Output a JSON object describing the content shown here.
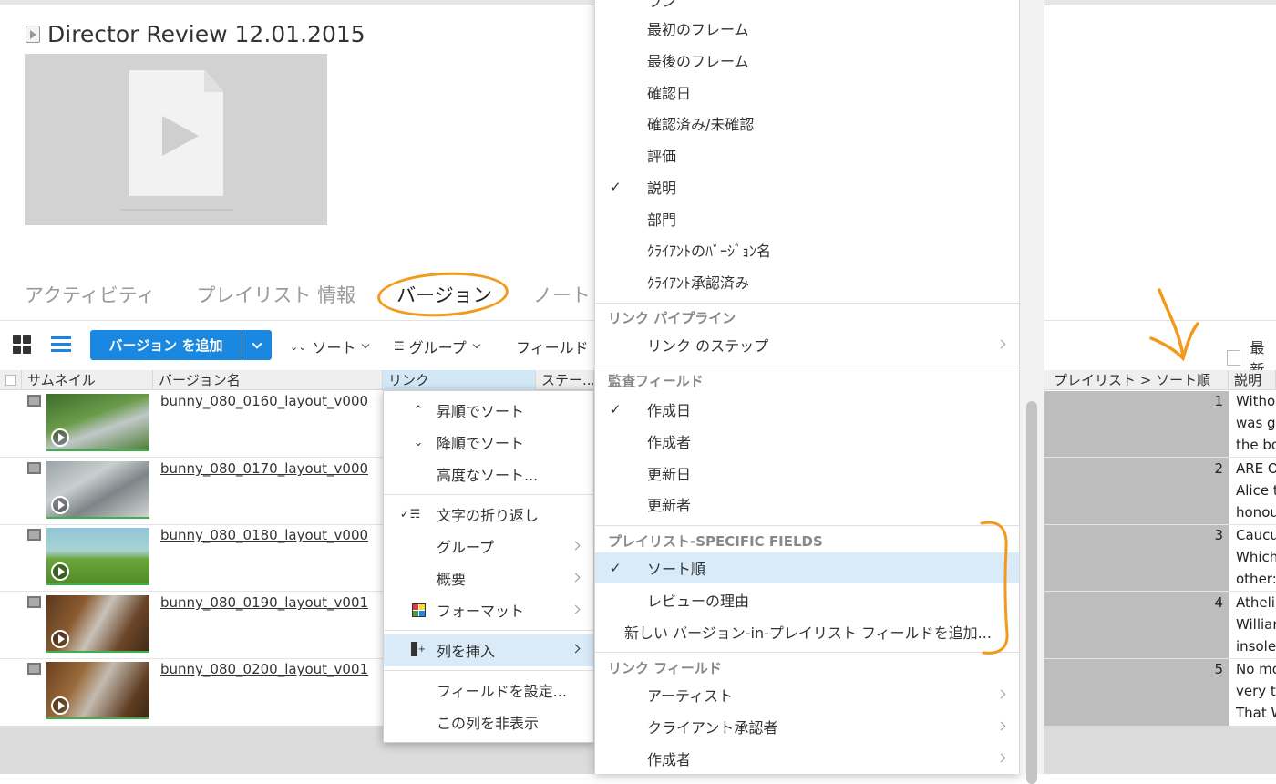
{
  "page": {
    "title": "Director Review 12.01.2015",
    "accent_color": "#1a88e0",
    "annotation_color": "#f39a1d"
  },
  "tabs": [
    {
      "label": "アクティビティ"
    },
    {
      "label": "プレイリスト 情報"
    },
    {
      "label": "バージョン"
    },
    {
      "label": "ノート"
    }
  ],
  "toolbar": {
    "add_label": "バージョン を追加",
    "sort_label": "ソート",
    "group_label": "グループ",
    "fields_label": "フィールド",
    "latest_label": "最新"
  },
  "columns": {
    "thumbnail": "サムネイル",
    "version_name": "バージョン名",
    "link": "リンク",
    "status": "ステー...",
    "sort_order": "プレイリスト > ソート順",
    "description": "説明"
  },
  "rows": [
    {
      "name": "bunny_080_0160_layout_v000",
      "sort": "1",
      "desc": [
        "Witho",
        "was g",
        "the bo"
      ]
    },
    {
      "name": "bunny_080_0170_layout_v000",
      "sort": "2",
      "desc": [
        "ARE O",
        "Alice t",
        "honou"
      ]
    },
    {
      "name": "bunny_080_0180_layout_v000",
      "sort": "3",
      "desc": [
        "Caucu",
        "Which",
        "other:"
      ]
    },
    {
      "name": "bunny_080_0190_layout_v001",
      "sort": "4",
      "desc": [
        "Atheli",
        "Willian",
        "insole"
      ]
    },
    {
      "name": "bunny_080_0200_layout_v001",
      "sort": "5",
      "desc": [
        "No mo",
        "very t",
        "That W"
      ]
    }
  ],
  "column_menu": [
    {
      "label": "昇順でソート",
      "icon": "chevron-up-icon"
    },
    {
      "label": "降順でソート",
      "icon": "chevron-down-icon"
    },
    {
      "label": "高度なソート..."
    },
    {
      "label": "文字の折り返し",
      "icon": "wrap-text-icon",
      "checked": true
    },
    {
      "label": "グループ",
      "submenu": true
    },
    {
      "label": "概要",
      "submenu": true
    },
    {
      "label": "フォーマット",
      "icon": "format-icon",
      "submenu": true
    },
    {
      "label": "列を挿入",
      "icon": "insert-column-icon",
      "submenu": true,
      "highlighted": true
    },
    {
      "label": "フィールドを設定..."
    },
    {
      "label": "この列を非表示"
    }
  ],
  "field_menu": {
    "cut_item": "ラン",
    "items_top": [
      {
        "label": "最初のフレーム"
      },
      {
        "label": "最後のフレーム"
      },
      {
        "label": "確認日"
      },
      {
        "label": "確認済み/未確認"
      },
      {
        "label": "評価"
      },
      {
        "label": "説明",
        "checked": true
      },
      {
        "label": "部門"
      },
      {
        "label": "ｸﾗｲｱﾝﾄのﾊﾞｰｼﾞｮﾝ名"
      },
      {
        "label": "ｸﾗｲｱﾝﾄ承認済み"
      }
    ],
    "section_pipeline": "リンク パイプライン",
    "pipeline_items": [
      {
        "label": "リンク のステップ",
        "submenu": true
      }
    ],
    "section_audit": "監査フィールド",
    "audit_items": [
      {
        "label": "作成日",
        "checked": true
      },
      {
        "label": "作成者"
      },
      {
        "label": "更新日"
      },
      {
        "label": "更新者"
      }
    ],
    "section_playlist": "プレイリスト-SPECIFIC FIELDS",
    "playlist_items": [
      {
        "label": "ソート順",
        "checked": true,
        "highlighted": true
      },
      {
        "label": "レビューの理由"
      }
    ],
    "add_field_label": "新しい バージョン-in-プレイリスト フィールドを追加...",
    "section_link": "リンク フィールド",
    "link_items": [
      {
        "label": "アーティスト",
        "submenu": true
      },
      {
        "label": "クライアント承認者",
        "submenu": true
      },
      {
        "label": "作成者",
        "submenu": true
      }
    ]
  }
}
